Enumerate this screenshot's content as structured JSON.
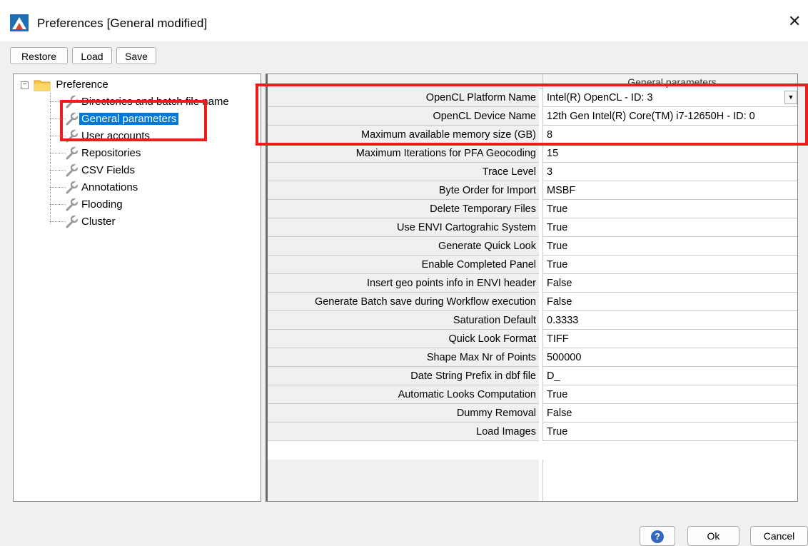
{
  "window": {
    "title": "Preferences [General modified]",
    "close_icon": "close-icon"
  },
  "toolbar": {
    "restore_label": "Restore",
    "load_label": "Load",
    "save_label": "Save"
  },
  "tree": {
    "root_label": "Preference",
    "items": [
      {
        "label": "Directories and batch file name"
      },
      {
        "label": "General parameters",
        "selected": true
      },
      {
        "label": "User accounts"
      },
      {
        "label": "Repositories"
      },
      {
        "label": "CSV Fields"
      },
      {
        "label": "Annotations"
      },
      {
        "label": "Flooding"
      },
      {
        "label": "Cluster"
      }
    ]
  },
  "grid": {
    "column_header": "General parameters",
    "rows": [
      {
        "name": "OpenCL Platform Name",
        "value": "Intel(R) OpenCL - ID: 3"
      },
      {
        "name": "OpenCL Device Name",
        "value": "12th Gen Intel(R) Core(TM) i7-12650H - ID: 0"
      },
      {
        "name": "Maximum available memory size (GB)",
        "value": "8"
      },
      {
        "name": "Maximum Iterations for PFA Geocoding",
        "value": "15"
      },
      {
        "name": "Trace Level",
        "value": "3"
      },
      {
        "name": "Byte Order for Import",
        "value": "MSBF"
      },
      {
        "name": "Delete Temporary Files",
        "value": "True"
      },
      {
        "name": "Use ENVI Cartograhic System",
        "value": "True"
      },
      {
        "name": "Generate Quick Look",
        "value": "True"
      },
      {
        "name": "Enable Completed Panel",
        "value": "True"
      },
      {
        "name": "Insert geo points info in ENVI header",
        "value": "False"
      },
      {
        "name": "Generate Batch save during Workflow execution",
        "value": "False"
      },
      {
        "name": "Saturation Default",
        "value": "0.3333"
      },
      {
        "name": "Quick Look Format",
        "value": "TIFF"
      },
      {
        "name": "Shape Max Nr of Points",
        "value": "500000"
      },
      {
        "name": "Date String Prefix in dbf file",
        "value": "D_"
      },
      {
        "name": "Automatic Looks Computation",
        "value": "True"
      },
      {
        "name": "Dummy Removal",
        "value": "False"
      },
      {
        "name": "Load Images",
        "value": "True"
      }
    ]
  },
  "buttons": {
    "help_label": "?",
    "ok_label": "Ok",
    "cancel_label": "Cancel"
  },
  "colors": {
    "highlight": "#ee1c1c",
    "selection": "#0078d7"
  }
}
